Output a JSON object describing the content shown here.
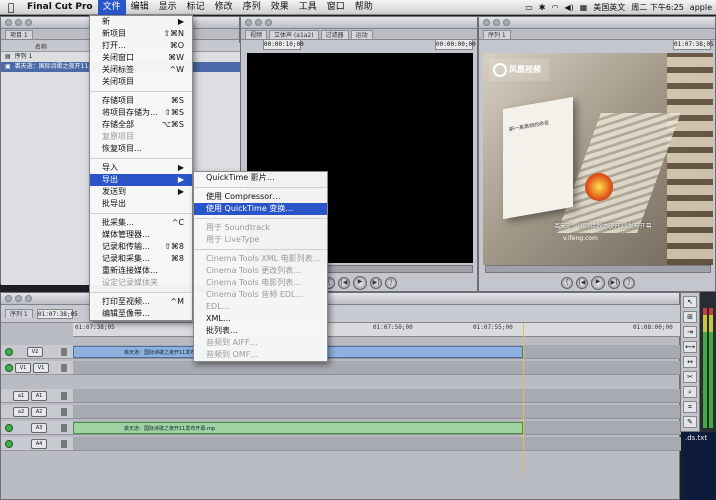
{
  "menubar": {
    "apple_icon": "",
    "app_name": "Final Cut Pro",
    "items": [
      "文件",
      "编辑",
      "显示",
      "标记",
      "修改",
      "序列",
      "效果",
      "工具",
      "窗口",
      "帮助"
    ],
    "input_lang": "美国英文",
    "clock": "周二 下午6:25",
    "user": "apple"
  },
  "browser": {
    "tab": "项目 1",
    "col_name": "名称",
    "rows": [
      "序列 1",
      "裘天逝：国际诗歌之夜开11发布开幕.mp"
    ]
  },
  "viewer": {
    "tabs": [
      "视频",
      "立体声 (a1a2)",
      "过滤器",
      "运动"
    ],
    "tc_left": "00:00:10;00",
    "tc_right": "00:00:00;00"
  },
  "canvas": {
    "tc_right": "01:07:38;05",
    "logo_text": "凤凰视频",
    "book_text": "斯一某高档的命名",
    "caption_line1": "裘天逝：国际诗歌之夜开11发布开幕",
    "caption_line2": "v.ifeng.com"
  },
  "timeline": {
    "tab": "序列 1",
    "tc": "01:07:38;05",
    "ruler": [
      "01:07:38;05",
      "01:07:50;00",
      "01:07:55;00",
      "01:08:00;00"
    ],
    "tracks": [
      {
        "a": "V2",
        "b": "V2",
        "clip": "裘天逝：国际诗歌之夜开11发布开幕.mp"
      },
      {
        "a": "V1",
        "b": "V1",
        "clip": ""
      },
      {
        "a": "a1",
        "b": "A1",
        "clip": ""
      },
      {
        "a": "a2",
        "b": "A2",
        "clip": ""
      },
      {
        "a": "",
        "b": "A3",
        "clip": "裘天逝：国际诗歌之夜开11发布开幕.mp"
      },
      {
        "a": "",
        "b": "A4",
        "clip": ""
      }
    ],
    "clip_label": "裘天逝：国际诗歌之夜开11发布开幕.mp"
  },
  "dstxt": ".ds.txt",
  "file_menu": [
    {
      "label": "新",
      "sc": "▶",
      "dis": false
    },
    {
      "label": "新项目",
      "sc": "⇧⌘N",
      "dis": false
    },
    {
      "label": "打开…",
      "sc": "⌘O",
      "dis": false
    },
    {
      "label": "关闭窗口",
      "sc": "⌘W",
      "dis": false
    },
    {
      "label": "关闭标签",
      "sc": "^W",
      "dis": false
    },
    {
      "label": "关闭项目",
      "sc": "",
      "dis": false
    },
    {
      "sep": true
    },
    {
      "label": "存储项目",
      "sc": "⌘S",
      "dis": false
    },
    {
      "label": "将项目存储为…",
      "sc": "⇧⌘S",
      "dis": false
    },
    {
      "label": "存储全部",
      "sc": "⌥⌘S",
      "dis": false
    },
    {
      "label": "复原项目",
      "sc": "",
      "dis": true
    },
    {
      "label": "恢复项目…",
      "sc": "",
      "dis": false
    },
    {
      "sep": true
    },
    {
      "label": "导入",
      "sc": "▶",
      "dis": false
    },
    {
      "label": "导出",
      "sc": "▶",
      "dis": false,
      "hi": true
    },
    {
      "label": "发送到",
      "sc": "▶",
      "dis": false
    },
    {
      "label": "批导出",
      "sc": "",
      "dis": false
    },
    {
      "sep": true
    },
    {
      "label": "批采集…",
      "sc": "^C",
      "dis": false
    },
    {
      "label": "媒体管理器…",
      "sc": "",
      "dis": false
    },
    {
      "label": "记录和传输…",
      "sc": "⇧⌘8",
      "dis": false
    },
    {
      "label": "记录和采集…",
      "sc": "⌘8",
      "dis": false
    },
    {
      "label": "重新连接媒体…",
      "sc": "",
      "dis": false
    },
    {
      "label": "设定记录媒体夹",
      "sc": "",
      "dis": true
    },
    {
      "sep": true
    },
    {
      "label": "打印至视频…",
      "sc": "^M",
      "dis": false
    },
    {
      "label": "编辑至像带…",
      "sc": "",
      "dis": false
    }
  ],
  "export_menu": [
    {
      "label": "QuickTime 影片…",
      "dis": false
    },
    {
      "sep": true
    },
    {
      "label": "使用 Compressor…",
      "dis": false
    },
    {
      "label": "使用 QuickTime 变换…",
      "dis": false,
      "hi": true
    },
    {
      "sep": true
    },
    {
      "label": "用于 Soundtrack",
      "dis": true
    },
    {
      "label": "用于 LiveType",
      "dis": true
    },
    {
      "sep": true
    },
    {
      "label": "Cinema Tools XML 电影列表…",
      "dis": true
    },
    {
      "label": "Cinema Tools 更改列表…",
      "dis": true
    },
    {
      "label": "Cinema Tools 电影列表…",
      "dis": true
    },
    {
      "label": "Cinema Tools 音频 EDL…",
      "dis": true
    },
    {
      "label": "EDL…",
      "dis": true
    },
    {
      "label": "XML…",
      "dis": false
    },
    {
      "label": "批列表…",
      "dis": false
    },
    {
      "label": "音频到 AIFF…",
      "dis": true
    },
    {
      "label": "音频到 OMF…",
      "dis": true
    }
  ]
}
